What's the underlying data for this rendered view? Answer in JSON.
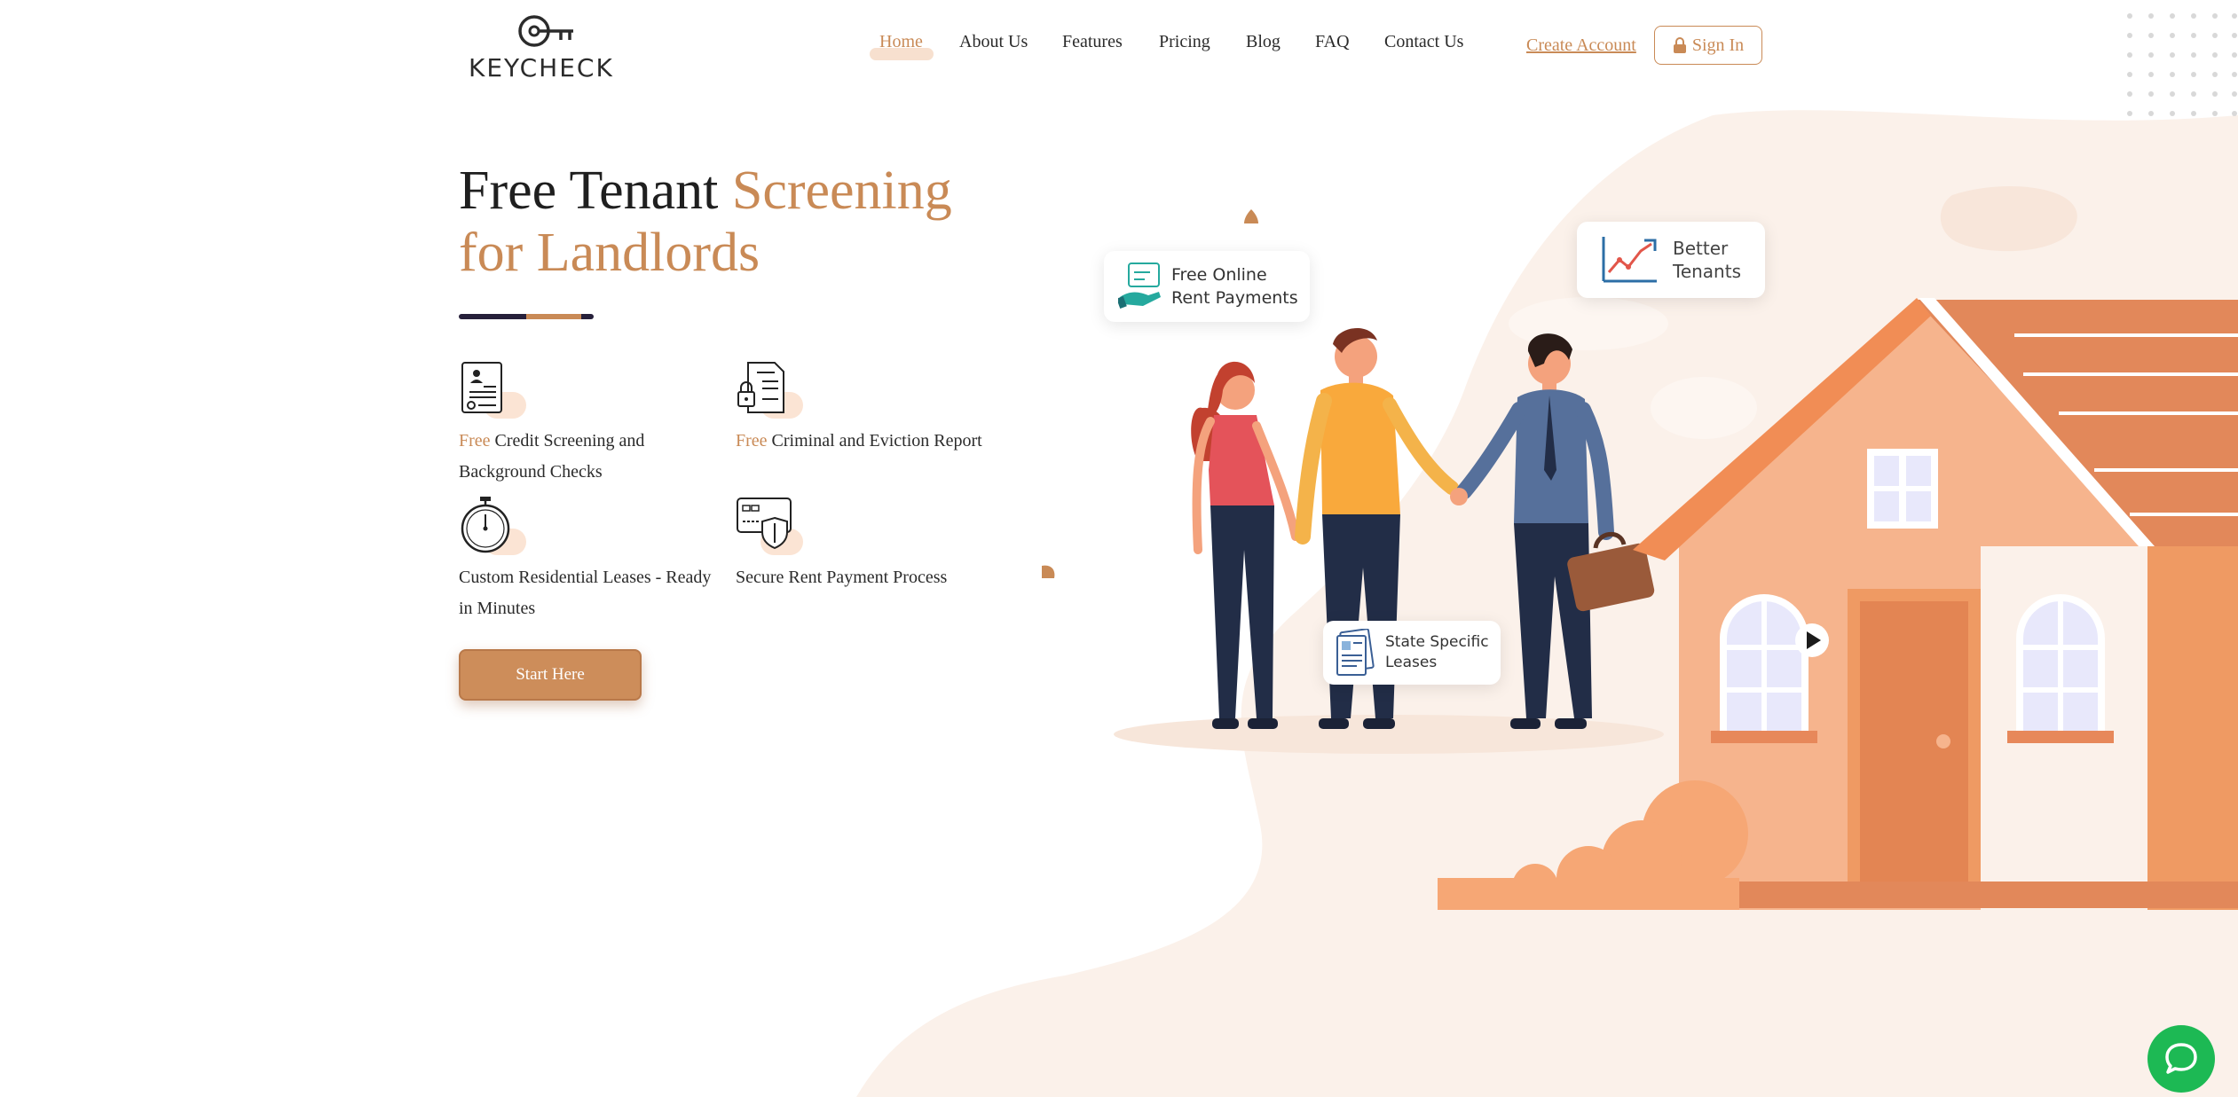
{
  "brand": {
    "logo_text": "KEYCHECK"
  },
  "nav": {
    "items": [
      {
        "label": "Home",
        "active": true
      },
      {
        "label": "About Us"
      },
      {
        "label": "Features"
      },
      {
        "label": "Pricing"
      },
      {
        "label": "Blog"
      },
      {
        "label": "FAQ"
      },
      {
        "label": "Contact Us"
      }
    ],
    "create_account": "Create Account",
    "sign_in": "Sign In"
  },
  "hero": {
    "title_line1_dark": "Free Tenant ",
    "title_line1_accent": "Screening",
    "title_line2_accent": "for Landlords",
    "features": [
      {
        "free": "Free",
        "text": " Credit Screening and Background Checks",
        "icon": "credit-report-icon"
      },
      {
        "free": "Free",
        "text": " Criminal and Eviction Report",
        "icon": "locked-document-icon"
      },
      {
        "free": "",
        "text": "Custom Residential Leases - Ready in Minutes",
        "icon": "stopwatch-icon"
      },
      {
        "free": "",
        "text": "Secure Rent Payment Process",
        "icon": "secure-card-icon"
      }
    ],
    "cta": "Start Here"
  },
  "cards": {
    "rent": "Free Online Rent Payments",
    "tenants": "Better Tenants",
    "leases": "State Specific Leases"
  },
  "colors": {
    "accent": "#c98a56",
    "dark": "#26203a",
    "chat": "#1db954",
    "house": "#f6b48d"
  }
}
